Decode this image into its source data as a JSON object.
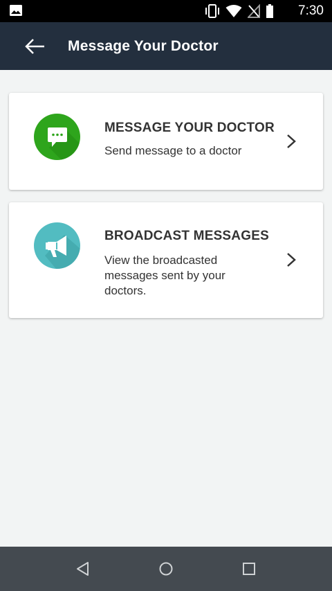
{
  "status_bar": {
    "time": "7:30",
    "icons": [
      "gallery-icon",
      "vibrate-icon",
      "wifi-icon",
      "no-sim-icon",
      "battery-icon"
    ]
  },
  "app_bar": {
    "title": "Message Your Doctor",
    "background": "#232f3e"
  },
  "cards": [
    {
      "heading": "MESSAGE YOUR DOCTOR",
      "description": "Send message to a doctor",
      "icon": "chat-bubble-icon",
      "icon_color": "#2ea51c"
    },
    {
      "heading": "BROADCAST MESSAGES",
      "description": "View the broadcasted messages sent by your doctors.",
      "icon": "megaphone-icon",
      "icon_color": "#52bcc1"
    }
  ],
  "nav_bar": {
    "buttons": [
      "back-icon",
      "home-icon",
      "recents-icon"
    ]
  }
}
